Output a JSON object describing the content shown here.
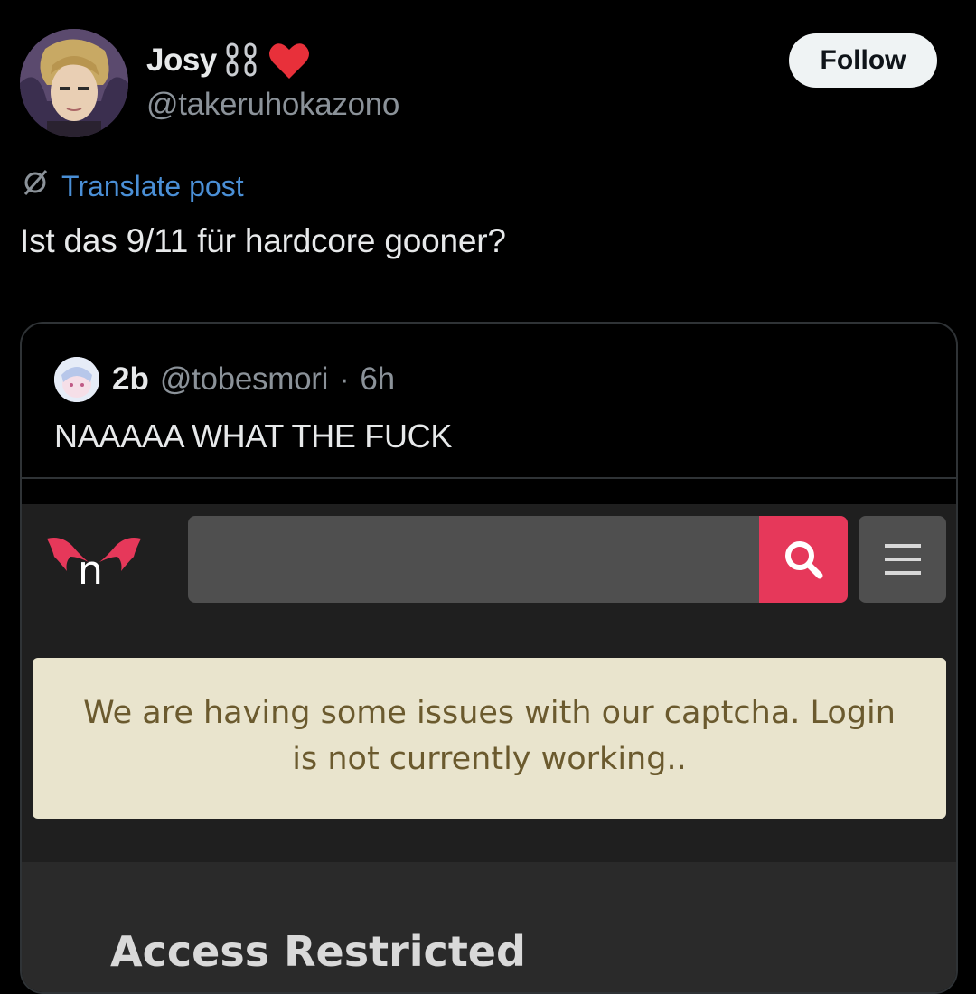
{
  "post": {
    "author": {
      "display_name": "Josy",
      "name_emojis": [
        "chain-icon",
        "red-heart-icon"
      ],
      "handle": "@takeruhokazono"
    },
    "follow_label": "Follow",
    "translate_label": "Translate post",
    "text": "Ist das 9/11 für hardcore gooner?"
  },
  "quote": {
    "author": {
      "display_name": "2b",
      "handle": "@tobesmori",
      "separator": "·",
      "time": "6h"
    },
    "text": "NAAAAA WHAT THE FUCK"
  },
  "site": {
    "logo_letter": "n",
    "search": {
      "value": "",
      "placeholder": ""
    },
    "notice": "We are having some issues with our captcha. Login is not currently working..",
    "access_title": "Access Restricted",
    "colors": {
      "brand": "#e6385a",
      "notice_bg": "#e9e4cd",
      "notice_text": "#6b5a2e"
    }
  },
  "colors": {
    "background": "#000000",
    "link": "#4a8fd6",
    "muted": "#8b9299"
  }
}
